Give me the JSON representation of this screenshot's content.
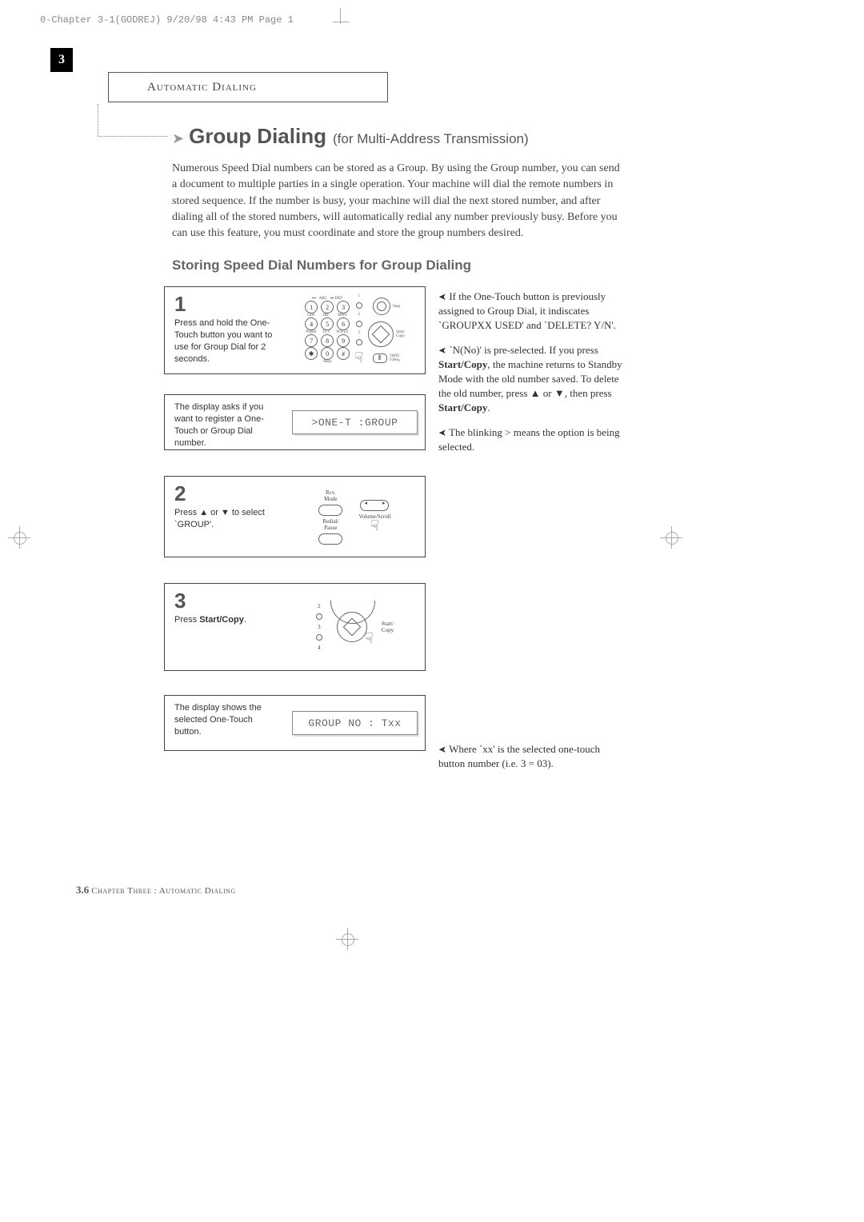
{
  "header": "0-Chapter 3-1(GODREJ)  9/20/98 4:43 PM  Page 1",
  "tab": "3",
  "chapter_box": "Automatic Dialing",
  "heading": "Group Dialing",
  "heading_sub": "(for Multi-Address Transmission)",
  "intro": "Numerous Speed Dial numbers can be stored as a Group. By using the Group number, you can send a document to multiple parties in a single operation. Your machine will dial the remote numbers in stored sequence. If the number is busy, your machine will dial the next stored number, and after dialing all of the stored numbers, will automatically redial any number previously busy. Before you can use this feature, you must coordinate and store the group numbers desired.",
  "sub_heading": "Storing Speed Dial Numbers for Group Dialing",
  "steps": [
    {
      "num": "1",
      "text": "Press and hold the One-Touch button you want to use for Group Dial for 2 seconds.",
      "lcd": ""
    },
    {
      "num": "",
      "text": "The display asks if you want to register a One-Touch or Group Dial number.",
      "lcd": ">ONE-T :GROUP"
    },
    {
      "num": "2",
      "text_pre": "Press ",
      "text_mid": " or ",
      "text_post": " to select `GROUP'.",
      "lcd": ""
    },
    {
      "num": "3",
      "text_pre": "Press ",
      "text_bold": "Start/Copy",
      "text_post": ".",
      "lcd": ""
    },
    {
      "num": "",
      "text": "The display shows the selected One-Touch button.",
      "lcd": "GROUP NO : Txx"
    }
  ],
  "notes": {
    "n1": "If the One-Touch button is previously assigned to Group Dial, it indiscates `GROUPXX USED' and `DELETE? Y/N'.",
    "n2_a": "`N(No)' is pre-selected. If you press ",
    "n2_b": "Start/Copy",
    "n2_c": ", the machine returns to Standby Mode with the old number saved. To delete the old number, press ",
    "n2_d": " or ",
    "n2_e": ", then press ",
    "n2_f": "Start/Copy",
    "n2_g": ".",
    "n3": "The blinking > means the option is being selected.",
    "n4": "Where `xx' is the selected one-touch button number (i.e. 3 = 03)."
  },
  "footer": {
    "page": "3.6",
    "chapter": "Chapter Three : Automatic Dialing"
  },
  "graphics": {
    "step1": {
      "stop": "Stop",
      "start_copy": "Start/\nCopy",
      "ohd": "OHD/\nV.Req.",
      "help": "Help",
      "abc": "ABC",
      "def": "DEF",
      "ghi": "GHI",
      "jkl": "JKL",
      "mno": "MNO",
      "pqrs": "PQRS",
      "tuv": "TUV",
      "wxyz": "WXYZ"
    },
    "step2": {
      "rcv": "Rcv.\nMode",
      "redial": "Redial/\nPause",
      "volume": "Volume/Scroll"
    },
    "step3": {
      "start_copy": "Start/\nCopy"
    }
  }
}
